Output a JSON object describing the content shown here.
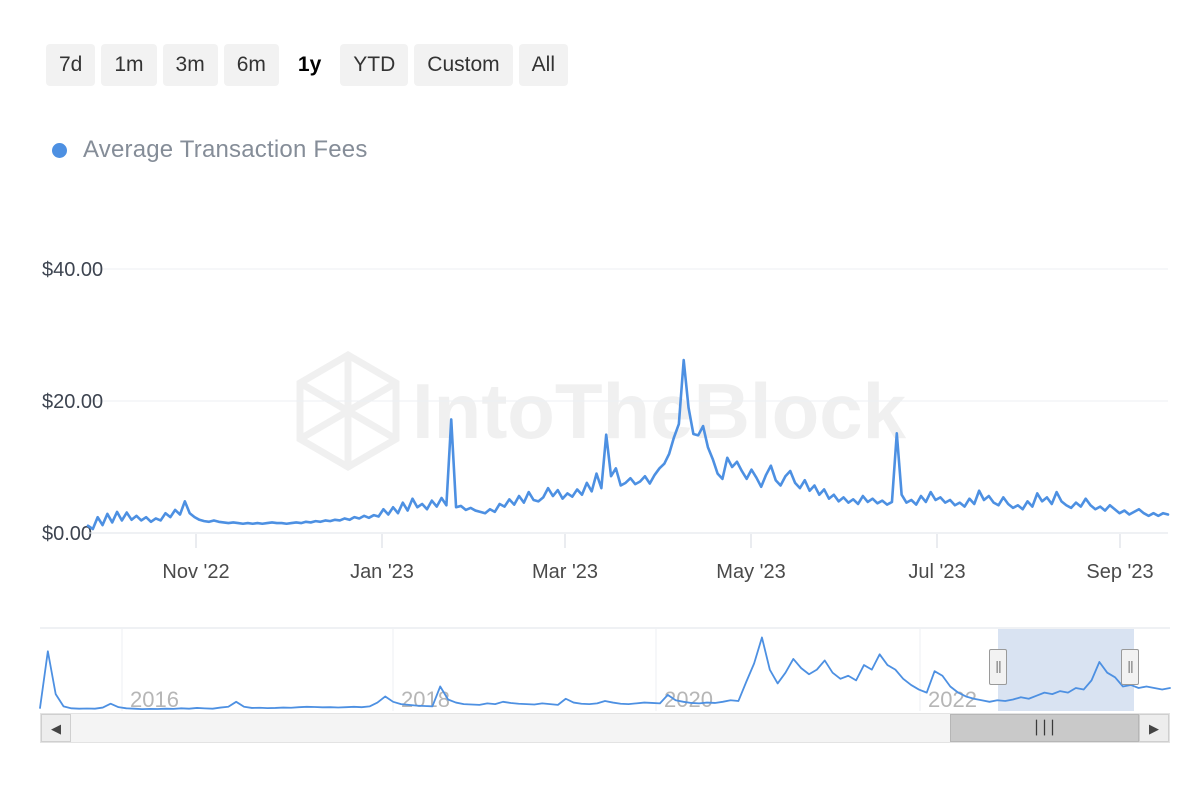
{
  "range_selector": {
    "buttons": [
      {
        "label": "7d",
        "active": false
      },
      {
        "label": "1m",
        "active": false
      },
      {
        "label": "3m",
        "active": false
      },
      {
        "label": "6m",
        "active": false
      },
      {
        "label": "1y",
        "active": true
      },
      {
        "label": "YTD",
        "active": false
      },
      {
        "label": "Custom",
        "active": false
      },
      {
        "label": "All",
        "active": false
      }
    ]
  },
  "legend": {
    "series_label": "Average Transaction Fees",
    "dot_color": "#4d90e2"
  },
  "watermark": {
    "text": "IntoTheBlock"
  },
  "navigator": {
    "year_labels": [
      "2016",
      "2018",
      "2020",
      "2022"
    ],
    "left_handle_grip": "‖",
    "right_handle_grip": "‖",
    "scroll_left_arrow": "◀",
    "scroll_right_arrow": "▶",
    "thumb_grip": "∣∣∣"
  },
  "chart_data": {
    "type": "line",
    "title": "",
    "xlabel": "",
    "ylabel": "",
    "grid": true,
    "legend_position": "top-left",
    "series": [
      {
        "name": "Average Transaction Fees",
        "color": "#4d90e2",
        "unit": "USD",
        "values": [
          1.1,
          0.6,
          2.4,
          1.2,
          2.9,
          1.6,
          3.2,
          1.9,
          3.1,
          2.0,
          2.6,
          1.9,
          2.4,
          1.7,
          2.2,
          1.9,
          3.0,
          2.4,
          3.5,
          2.8,
          4.8,
          3.0,
          2.4,
          2.0,
          1.8,
          1.7,
          1.9,
          1.7,
          1.6,
          1.5,
          1.6,
          1.5,
          1.4,
          1.5,
          1.4,
          1.5,
          1.4,
          1.5,
          1.6,
          1.5,
          1.5,
          1.4,
          1.5,
          1.6,
          1.5,
          1.7,
          1.6,
          1.8,
          1.7,
          1.9,
          1.8,
          2.0,
          1.9,
          2.2,
          2.0,
          2.4,
          2.2,
          2.6,
          2.3,
          2.7,
          2.5,
          3.6,
          2.8,
          3.9,
          3.0,
          4.6,
          3.4,
          5.2,
          3.9,
          4.4,
          3.6,
          4.9,
          4.0,
          5.3,
          4.2,
          17.2,
          3.9,
          4.1,
          3.5,
          3.8,
          3.4,
          3.2,
          3.0,
          3.6,
          3.2,
          4.4,
          4.0,
          5.1,
          4.3,
          5.6,
          4.6,
          6.2,
          5.0,
          4.8,
          5.4,
          6.8,
          5.6,
          6.5,
          5.2,
          6.0,
          5.5,
          6.6,
          5.8,
          7.6,
          6.3,
          9.0,
          6.8,
          14.9,
          8.6,
          9.8,
          7.2,
          7.6,
          8.3,
          7.4,
          7.8,
          8.6,
          7.5,
          8.8,
          9.8,
          10.5,
          12.0,
          14.5,
          16.5,
          26.2,
          19.0,
          15.0,
          14.8,
          16.2,
          13.0,
          11.2,
          9.0,
          8.2,
          11.4,
          10.0,
          10.8,
          9.4,
          8.2,
          9.6,
          8.4,
          7.0,
          8.8,
          10.2,
          8.0,
          7.2,
          8.6,
          9.4,
          7.6,
          6.8,
          8.0,
          6.4,
          7.2,
          5.8,
          6.6,
          5.2,
          5.8,
          4.8,
          5.4,
          4.6,
          5.1,
          4.4,
          5.6,
          4.7,
          5.2,
          4.5,
          4.9,
          4.3,
          4.7,
          15.1,
          5.8,
          4.6,
          5.0,
          4.3,
          5.6,
          4.7,
          6.2,
          5.0,
          5.4,
          4.6,
          5.0,
          4.2,
          4.6,
          4.0,
          5.2,
          4.4,
          6.4,
          5.0,
          5.6,
          4.6,
          4.2,
          5.4,
          4.4,
          3.8,
          4.2,
          3.6,
          4.8,
          4.0,
          6.0,
          4.8,
          5.4,
          4.4,
          6.2,
          4.8,
          4.2,
          3.8,
          4.6,
          4.0,
          5.2,
          4.2,
          3.6,
          4.0,
          3.4,
          4.2,
          3.6,
          3.0,
          3.4,
          2.8,
          3.2,
          3.6,
          3.0,
          2.6,
          3.0,
          2.6,
          3.0,
          2.8
        ]
      }
    ],
    "x_tick_labels": [
      "Nov '22",
      "Jan '23",
      "Mar '23",
      "May '23",
      "Jul '23",
      "Sep '23"
    ],
    "y_tick_labels": [
      "$0.00",
      "$20.00",
      "$40.00"
    ],
    "y_tick_values": [
      0,
      20,
      40
    ],
    "ylim": [
      0,
      45
    ],
    "navigator_series": {
      "name": "Average Transaction Fees (full history)",
      "values": [
        0.4,
        7.8,
        2.2,
        0.6,
        0.35,
        0.3,
        0.33,
        0.3,
        0.45,
        0.95,
        0.5,
        0.35,
        0.3,
        0.25,
        0.28,
        0.26,
        0.3,
        0.28,
        0.35,
        0.3,
        0.4,
        0.34,
        0.3,
        0.45,
        0.55,
        1.2,
        0.55,
        0.4,
        0.42,
        0.38,
        0.4,
        0.45,
        0.42,
        0.5,
        0.55,
        0.52,
        0.48,
        0.5,
        0.46,
        0.5,
        0.55,
        0.5,
        0.6,
        1.1,
        1.9,
        1.2,
        0.9,
        0.8,
        0.7,
        0.65,
        0.6,
        3.2,
        1.5,
        1.1,
        0.9,
        0.85,
        0.8,
        1.0,
        0.9,
        1.2,
        1.05,
        0.95,
        0.9,
        0.85,
        1.0,
        0.9,
        0.8,
        1.6,
        1.1,
        0.95,
        0.9,
        1.0,
        1.3,
        1.1,
        0.95,
        0.9,
        1.0,
        1.1,
        1.05,
        1.0,
        2.1,
        1.4,
        1.2,
        1.05,
        1.0,
        1.1,
        1.05,
        1.2,
        1.4,
        1.3,
        3.8,
        6.2,
        9.6,
        5.4,
        3.6,
        5.0,
        6.8,
        5.6,
        4.8,
        5.4,
        6.6,
        5.0,
        4.2,
        4.6,
        4.0,
        6.0,
        5.4,
        7.4,
        6.0,
        5.4,
        4.2,
        3.4,
        2.8,
        2.4,
        5.2,
        4.6,
        3.2,
        2.4,
        1.9,
        1.6,
        1.4,
        1.2,
        1.4,
        1.3,
        1.5,
        1.8,
        1.6,
        2.0,
        2.4,
        2.2,
        2.6,
        2.4,
        3.0,
        2.8,
        4.0,
        6.4,
        5.0,
        4.4,
        3.2,
        3.4,
        3.0,
        3.2,
        3.0,
        2.8,
        3.0
      ]
    }
  }
}
